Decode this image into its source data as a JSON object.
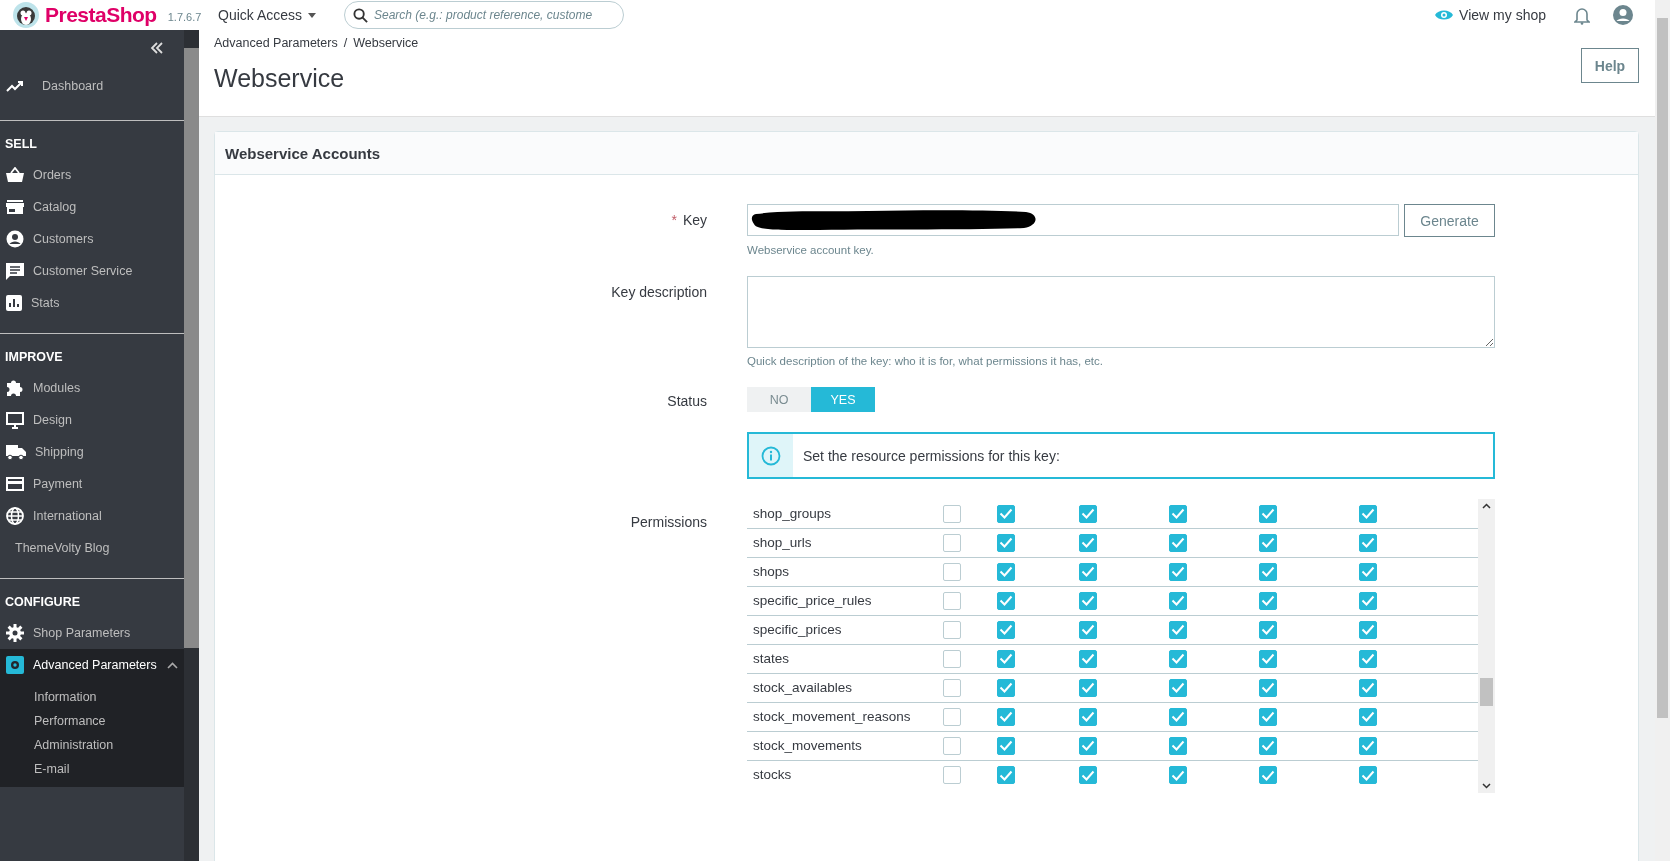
{
  "header": {
    "brand": "PrestaShop",
    "version": "1.7.6.7",
    "quick_access": "Quick Access",
    "search": {
      "placeholder": "Search (e.g.: product reference, custome"
    },
    "view_shop": "View my shop"
  },
  "sidebar": {
    "dashboard": "Dashboard",
    "sections": [
      {
        "title": "SELL",
        "items": [
          {
            "label": "Orders",
            "selected": false,
            "expanded": false
          },
          {
            "label": "Catalog",
            "selected": false,
            "expanded": false
          },
          {
            "label": "Customers",
            "selected": false,
            "expanded": false
          },
          {
            "label": "Customer Service",
            "selected": false,
            "expanded": false
          },
          {
            "label": "Stats",
            "selected": false,
            "expanded": false
          }
        ]
      },
      {
        "title": "IMPROVE",
        "items": [
          {
            "label": "Modules",
            "selected": false,
            "expanded": false
          },
          {
            "label": "Design",
            "selected": false,
            "expanded": false
          },
          {
            "label": "Shipping",
            "selected": false,
            "expanded": false
          },
          {
            "label": "Payment",
            "selected": false,
            "expanded": false
          },
          {
            "label": "International",
            "selected": false,
            "expanded": false
          },
          {
            "label": "ThemeVolty Blog",
            "selected": false,
            "expanded": false
          }
        ]
      },
      {
        "title": "CONFIGURE",
        "items": [
          {
            "label": "Shop Parameters",
            "selected": false,
            "expanded": false
          },
          {
            "label": "Advanced Parameters",
            "selected": true,
            "expanded": true,
            "children": [
              "Information",
              "Performance",
              "Administration",
              "E-mail"
            ]
          }
        ]
      }
    ]
  },
  "breadcrumb": {
    "items": [
      "Advanced Parameters",
      "Webservice"
    ],
    "separator": "/"
  },
  "page_title": "Webservice",
  "help_button": "Help",
  "card": {
    "title": "Webservice Accounts",
    "key": {
      "label": "Key",
      "required_mark": "*",
      "generate_button": "Generate",
      "hint": "Webservice account key."
    },
    "description": {
      "label": "Key description",
      "hint": "Quick description of the key: who it is for, what permissions it has, etc."
    },
    "status": {
      "label": "Status",
      "options": [
        {
          "label": "NO",
          "selected": false
        },
        {
          "label": "YES",
          "selected": true
        }
      ]
    },
    "info": "Set the resource permissions for this key:",
    "permissions": {
      "label": "Permissions",
      "rows": [
        {
          "resource": "shop_groups",
          "checked": [
            false,
            true,
            true,
            true,
            true,
            true
          ]
        },
        {
          "resource": "shop_urls",
          "checked": [
            false,
            true,
            true,
            true,
            true,
            true
          ]
        },
        {
          "resource": "shops",
          "checked": [
            false,
            true,
            true,
            true,
            true,
            true
          ]
        },
        {
          "resource": "specific_price_rules",
          "checked": [
            false,
            true,
            true,
            true,
            true,
            true
          ]
        },
        {
          "resource": "specific_prices",
          "checked": [
            false,
            true,
            true,
            true,
            true,
            true
          ]
        },
        {
          "resource": "states",
          "checked": [
            false,
            true,
            true,
            true,
            true,
            true
          ]
        },
        {
          "resource": "stock_availables",
          "checked": [
            false,
            true,
            true,
            true,
            true,
            true
          ]
        },
        {
          "resource": "stock_movement_reasons",
          "checked": [
            false,
            true,
            true,
            true,
            true,
            true
          ]
        },
        {
          "resource": "stock_movements",
          "checked": [
            false,
            true,
            true,
            true,
            true,
            true
          ]
        },
        {
          "resource": "stocks",
          "checked": [
            false,
            true,
            true,
            true,
            true,
            true
          ]
        }
      ]
    }
  }
}
